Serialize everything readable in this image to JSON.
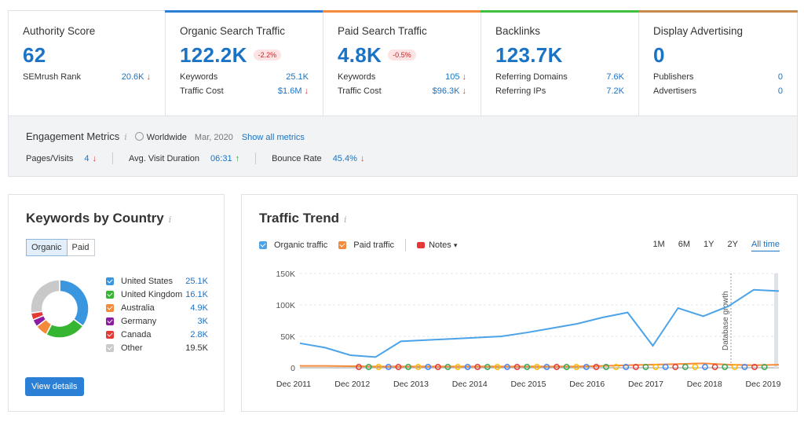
{
  "cards": [
    {
      "title": "Authority Score",
      "big": "62",
      "pill": "",
      "bar_color": "",
      "rows": [
        {
          "label": "SEMrush Rank",
          "value": "20.6K",
          "arrow": "↓"
        }
      ]
    },
    {
      "title": "Organic Search Traffic",
      "big": "122.2K",
      "pill": "-2.2%",
      "bar_color": "#2b7fd4",
      "rows": [
        {
          "label": "Keywords",
          "value": "25.1K",
          "arrow": ""
        },
        {
          "label": "Traffic Cost",
          "value": "$1.6M",
          "arrow": "↓"
        }
      ]
    },
    {
      "title": "Paid Search Traffic",
      "big": "4.8K",
      "pill": "-0.5%",
      "bar_color": "#f58a3a",
      "rows": [
        {
          "label": "Keywords",
          "value": "105",
          "arrow": "↓"
        },
        {
          "label": "Traffic Cost",
          "value": "$96.3K",
          "arrow": "↓"
        }
      ]
    },
    {
      "title": "Backlinks",
      "big": "123.7K",
      "pill": "",
      "bar_color": "#3ec03e",
      "rows": [
        {
          "label": "Referring Domains",
          "value": "7.6K",
          "arrow": ""
        },
        {
          "label": "Referring IPs",
          "value": "7.2K",
          "arrow": ""
        }
      ]
    },
    {
      "title": "Display Advertising",
      "big": "0",
      "pill": "",
      "bar_color": "#c68b4c",
      "rows": [
        {
          "label": "Publishers",
          "value": "0",
          "arrow": ""
        },
        {
          "label": "Advertisers",
          "value": "0",
          "arrow": ""
        }
      ]
    }
  ],
  "engagement": {
    "title": "Engagement Metrics",
    "info": "i",
    "region": "Worldwide",
    "date": "Mar, 2020",
    "show_all": "Show all metrics",
    "metrics": [
      {
        "label": "Pages/Visits",
        "value": "4",
        "arrow": "↓",
        "dir": "down"
      },
      {
        "label": "Avg. Visit Duration",
        "value": "06:31",
        "arrow": "↑",
        "dir": "up"
      },
      {
        "label": "Bounce Rate",
        "value": "45.4%",
        "arrow": "↓",
        "dir": "down"
      }
    ]
  },
  "kbc": {
    "title": "Keywords by Country",
    "info": "i",
    "tabs": [
      "Organic",
      "Paid"
    ],
    "countries": [
      {
        "name": "United States",
        "value": "25.1K",
        "color": "#3b96e0",
        "checked": true
      },
      {
        "name": "United Kingdom",
        "value": "16.1K",
        "color": "#36b532",
        "checked": true
      },
      {
        "name": "Australia",
        "value": "4.9K",
        "color": "#f58a3a",
        "checked": true
      },
      {
        "name": "Germany",
        "value": "3K",
        "color": "#8b1ea0",
        "checked": true
      },
      {
        "name": "Canada",
        "value": "2.8K",
        "color": "#e53935",
        "checked": true
      },
      {
        "name": "Other",
        "value": "19.5K",
        "color": "#c9c9c9",
        "checked": true
      }
    ],
    "view_details": "View details"
  },
  "trend": {
    "title": "Traffic Trend",
    "info": "i",
    "organic_label": "Organic traffic",
    "paid_label": "Paid traffic",
    "notes_label": "Notes",
    "ranges": [
      "1M",
      "6M",
      "1Y",
      "2Y",
      "All time"
    ],
    "active_range": "All time",
    "db_growth_label": "Database growth"
  },
  "chart_data": {
    "type": "line",
    "x": [
      "Dec 2011",
      "Jun 2012",
      "Dec 2012",
      "Jun 2013",
      "Dec 2013",
      "Jun 2014",
      "Dec 2014",
      "Jun 2015",
      "Dec 2015",
      "Jun 2016",
      "Dec 2016",
      "Jun 2017",
      "Dec 2017",
      "Apr 2018",
      "Jun 2018",
      "Dec 2018",
      "Mar 2019",
      "Jun 2019",
      "Dec 2019",
      "Mar 2020"
    ],
    "xticks": [
      "Dec 2011",
      "Dec 2012",
      "Dec 2013",
      "Dec 2014",
      "Dec 2015",
      "Dec 2016",
      "Dec 2017",
      "Dec 2018",
      "Dec 2019"
    ],
    "yticks": [
      "0",
      "50K",
      "100K",
      "150K"
    ],
    "ylim": [
      0,
      150000
    ],
    "series": [
      {
        "name": "Organic traffic",
        "color": "#4ca3e8",
        "values": [
          39000,
          32000,
          20000,
          17000,
          42000,
          44000,
          46000,
          48000,
          50000,
          56000,
          63000,
          70000,
          80000,
          88000,
          35000,
          95000,
          82000,
          98000,
          124000,
          122000
        ]
      },
      {
        "name": "Paid traffic",
        "color": "#f58a3a",
        "values": [
          3000,
          3000,
          2500,
          2000,
          2000,
          2000,
          2000,
          2000,
          2000,
          2000,
          2000,
          2000,
          3000,
          4000,
          5000,
          6000,
          7000,
          5000,
          4000,
          4800
        ]
      }
    ]
  }
}
